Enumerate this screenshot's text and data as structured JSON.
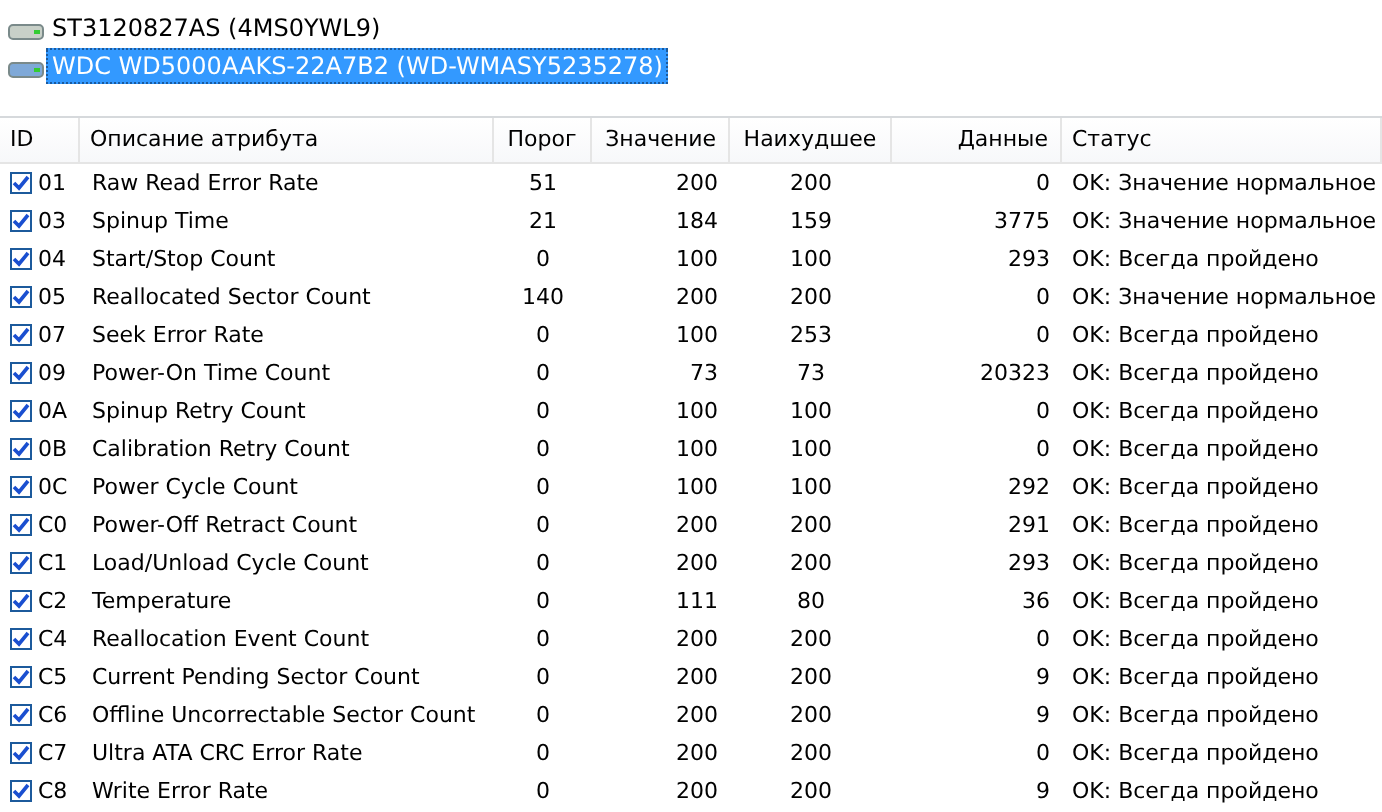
{
  "drives": [
    {
      "name": "ST3120827AS (4MS0YWL9)",
      "selected": false
    },
    {
      "name": "WDC WD5000AAKS-22A7B2 (WD-WMASY5235278)",
      "selected": true
    }
  ],
  "table": {
    "columns": [
      "ID",
      "Описание атрибута",
      "Порог",
      "Значение",
      "Наихудшее",
      "Данные",
      "Статус"
    ],
    "rows": [
      {
        "checked": true,
        "id": "01",
        "name": "Raw Read Error Rate",
        "threshold": "51",
        "value": "200",
        "worst": "200",
        "data": "0",
        "status": "OK: Значение нормальное"
      },
      {
        "checked": true,
        "id": "03",
        "name": "Spinup Time",
        "threshold": "21",
        "value": "184",
        "worst": "159",
        "data": "3775",
        "status": "OK: Значение нормальное"
      },
      {
        "checked": true,
        "id": "04",
        "name": "Start/Stop Count",
        "threshold": "0",
        "value": "100",
        "worst": "100",
        "data": "293",
        "status": "OK: Всегда пройдено"
      },
      {
        "checked": true,
        "id": "05",
        "name": "Reallocated Sector Count",
        "threshold": "140",
        "value": "200",
        "worst": "200",
        "data": "0",
        "status": "OK: Значение нормальное"
      },
      {
        "checked": true,
        "id": "07",
        "name": "Seek Error Rate",
        "threshold": "0",
        "value": "100",
        "worst": "253",
        "data": "0",
        "status": "OK: Всегда пройдено"
      },
      {
        "checked": true,
        "id": "09",
        "name": "Power-On Time Count",
        "threshold": "0",
        "value": "73",
        "worst": "73",
        "data": "20323",
        "status": "OK: Всегда пройдено"
      },
      {
        "checked": true,
        "id": "0A",
        "name": "Spinup Retry Count",
        "threshold": "0",
        "value": "100",
        "worst": "100",
        "data": "0",
        "status": "OK: Всегда пройдено"
      },
      {
        "checked": true,
        "id": "0B",
        "name": "Calibration Retry Count",
        "threshold": "0",
        "value": "100",
        "worst": "100",
        "data": "0",
        "status": "OK: Всегда пройдено"
      },
      {
        "checked": true,
        "id": "0C",
        "name": "Power Cycle Count",
        "threshold": "0",
        "value": "100",
        "worst": "100",
        "data": "292",
        "status": "OK: Всегда пройдено"
      },
      {
        "checked": true,
        "id": "C0",
        "name": "Power-Off Retract Count",
        "threshold": "0",
        "value": "200",
        "worst": "200",
        "data": "291",
        "status": "OK: Всегда пройдено"
      },
      {
        "checked": true,
        "id": "C1",
        "name": "Load/Unload Cycle Count",
        "threshold": "0",
        "value": "200",
        "worst": "200",
        "data": "293",
        "status": "OK: Всегда пройдено"
      },
      {
        "checked": true,
        "id": "C2",
        "name": "Temperature",
        "threshold": "0",
        "value": "111",
        "worst": "80",
        "data": "36",
        "status": "OK: Всегда пройдено"
      },
      {
        "checked": true,
        "id": "C4",
        "name": "Reallocation Event Count",
        "threshold": "0",
        "value": "200",
        "worst": "200",
        "data": "0",
        "status": "OK: Всегда пройдено"
      },
      {
        "checked": true,
        "id": "C5",
        "name": "Current Pending Sector Count",
        "threshold": "0",
        "value": "200",
        "worst": "200",
        "data": "9",
        "status": "OK: Всегда пройдено"
      },
      {
        "checked": true,
        "id": "C6",
        "name": "Offline Uncorrectable Sector Count",
        "threshold": "0",
        "value": "200",
        "worst": "200",
        "data": "9",
        "status": "OK: Всегда пройдено"
      },
      {
        "checked": true,
        "id": "C7",
        "name": "Ultra ATA CRC Error Rate",
        "threshold": "0",
        "value": "200",
        "worst": "200",
        "data": "0",
        "status": "OK: Всегда пройдено"
      },
      {
        "checked": true,
        "id": "C8",
        "name": "Write Error Rate",
        "threshold": "0",
        "value": "200",
        "worst": "200",
        "data": "9",
        "status": "OK: Всегда пройдено"
      }
    ]
  }
}
